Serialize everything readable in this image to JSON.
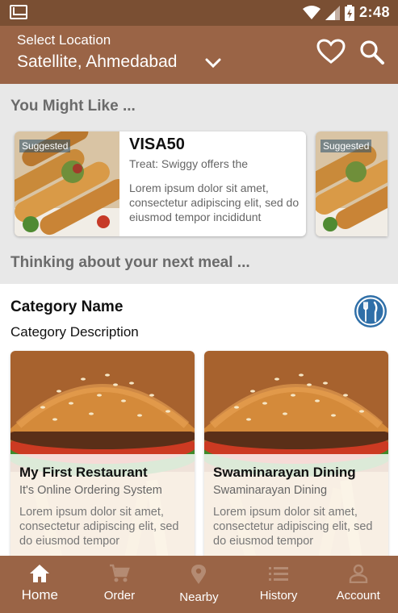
{
  "status_bar": {
    "time": "2:48"
  },
  "header": {
    "location_label": "Select Location",
    "location_value": "Satellite, Ahmedabad"
  },
  "sections": {
    "you_might_like": "You Might Like ...",
    "next_meal": "Thinking about your next meal ..."
  },
  "promo": {
    "badge": "Suggested",
    "title": "VISA50",
    "subtitle": "Treat: Swiggy offers the",
    "description": "Lorem ipsum dolor sit amet, consectetur adipiscing elit, sed do eiusmod tempor incididunt",
    "badge_next": "Suggested"
  },
  "category": {
    "name": "Category Name",
    "description": "Category Description",
    "icon": "restaurant-icon"
  },
  "restaurants": [
    {
      "name": "My First Restaurant",
      "tagline": "It's Online Ordering System",
      "description": "Lorem ipsum dolor sit amet, consectetur adipiscing elit, sed do eiusmod tempor"
    },
    {
      "name": "Swaminarayan Dining",
      "tagline": "Swaminarayan Dining",
      "description": "Lorem ipsum dolor sit amet, consectetur adipiscing elit, sed do eiusmod tempor"
    }
  ],
  "nav": {
    "items": [
      {
        "label": "Home",
        "icon": "home-icon"
      },
      {
        "label": "Order",
        "icon": "cart-icon"
      },
      {
        "label": "Nearby",
        "icon": "location-pin-icon"
      },
      {
        "label": "History",
        "icon": "list-icon"
      },
      {
        "label": "Account",
        "icon": "person-icon"
      }
    ]
  },
  "colors": {
    "header_brown": "#9a6446",
    "status_brown": "#7a4f33",
    "badge_blue": "#28506e",
    "category_icon_blue": "#2f6fa8"
  }
}
